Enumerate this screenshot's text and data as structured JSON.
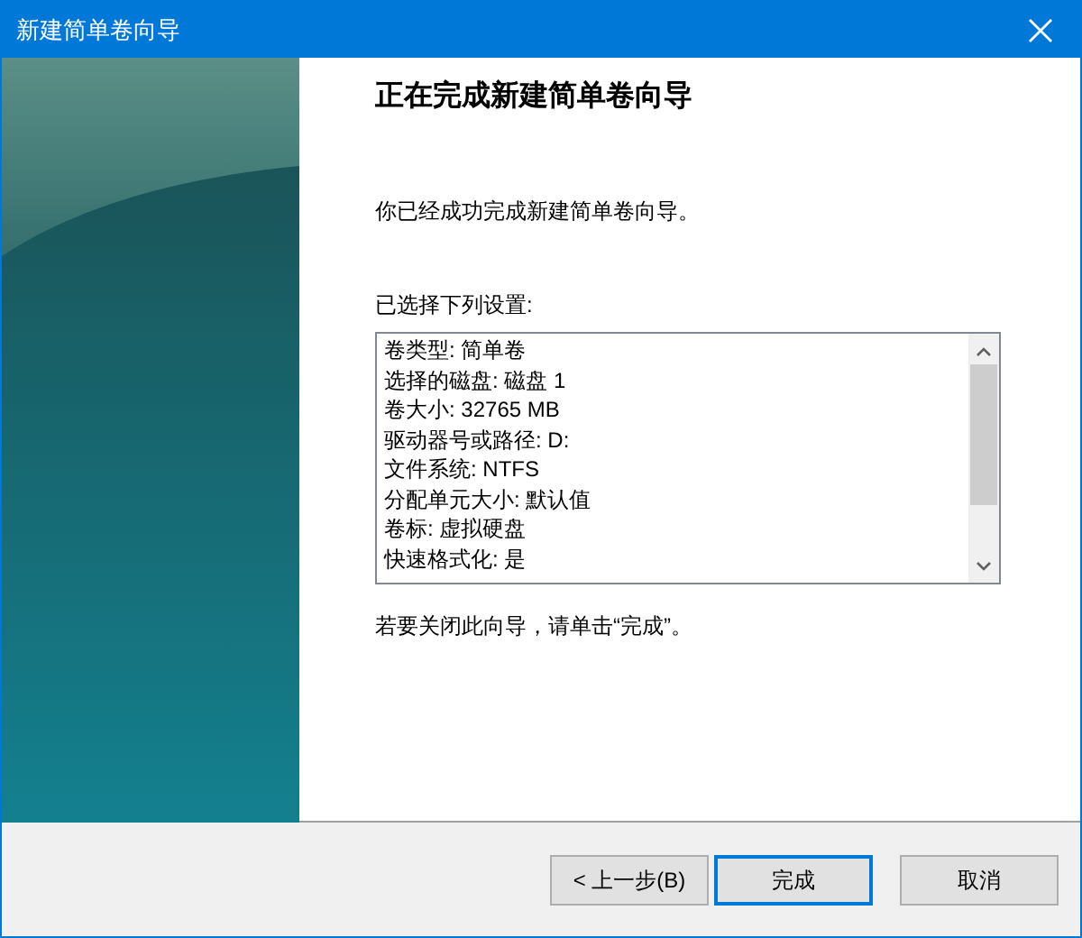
{
  "window": {
    "title": "新建简单卷向导"
  },
  "heading": "正在完成新建简单卷向导",
  "intro": "你已经成功完成新建简单卷向导。",
  "settings_label": "已选择下列设置:",
  "settings": [
    "卷类型: 简单卷",
    "选择的磁盘: 磁盘 1",
    "卷大小: 32765 MB",
    "驱动器号或路径: D:",
    "文件系统: NTFS",
    "分配单元大小: 默认值",
    "卷标: 虚拟硬盘",
    "快速格式化: 是"
  ],
  "closing_note": "若要关闭此向导，请单击“完成”。",
  "buttons": [
    {
      "label": "< 上一步(B)",
      "default": false
    },
    {
      "label": "完成",
      "default": true
    },
    {
      "label": "取消",
      "default": false
    }
  ]
}
